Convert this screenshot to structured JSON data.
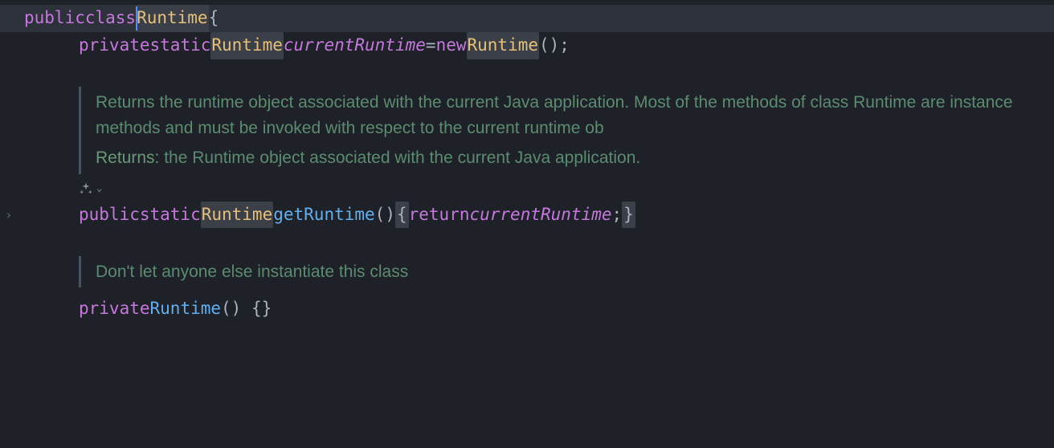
{
  "line1": {
    "kw_public": "public",
    "kw_class": "class",
    "type": "Runtime",
    "brace": "{"
  },
  "line2": {
    "kw_private": "private",
    "kw_static": "static",
    "type": "Runtime",
    "field": "currentRuntime",
    "eq": "=",
    "kw_new": "new",
    "ctor": "Runtime",
    "parens_semi": "();"
  },
  "doc1": {
    "p1": "Returns the runtime object associated with the current Java application. Most of the methods of class Runtime are instance methods and must be invoked with respect to the current runtime ob",
    "returns_label": "Returns:",
    "returns_text": " the Runtime object associated with the current Java application."
  },
  "line3": {
    "kw_public": "public",
    "kw_static": "static",
    "type": "Runtime",
    "method": "getRuntime",
    "parens": "()",
    "brace_open": "{",
    "kw_return": "return",
    "field": "currentRuntime",
    "semi": ";",
    "brace_close": "}"
  },
  "doc2": {
    "text": "Don't let anyone else instantiate this class"
  },
  "line4": {
    "kw_private": "private",
    "ctor": "Runtime",
    "rest": "() {}"
  }
}
